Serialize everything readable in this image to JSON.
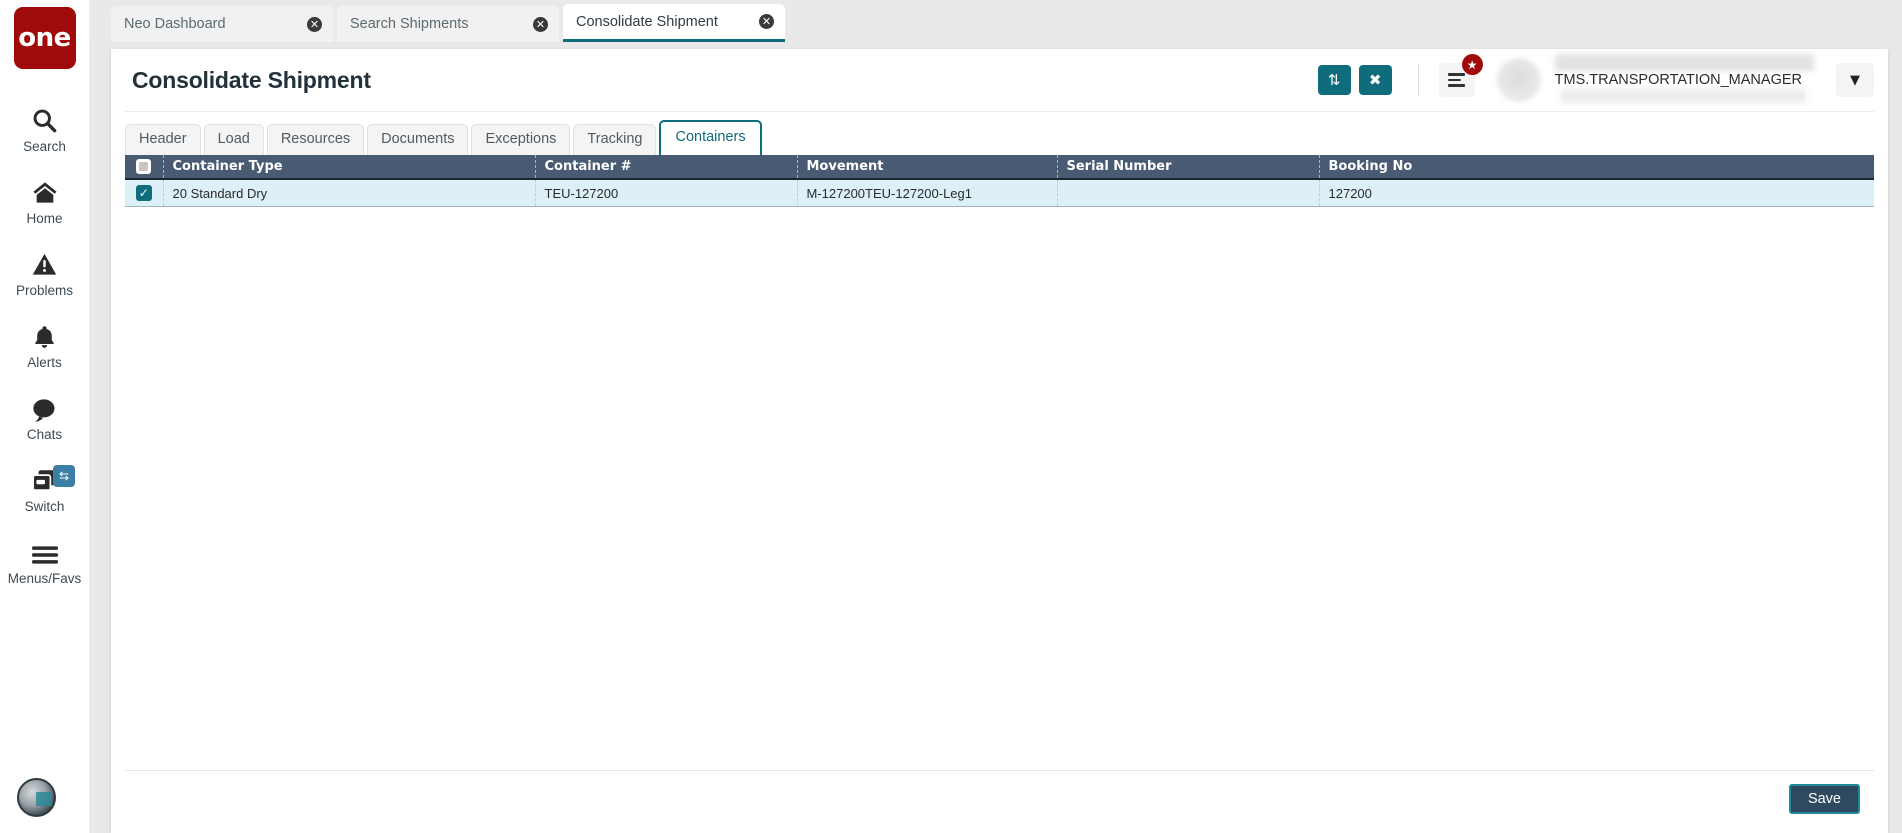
{
  "brand": {
    "logo_text": "one"
  },
  "sidebar": {
    "items": [
      {
        "label": "Search",
        "icon": "search-icon"
      },
      {
        "label": "Home",
        "icon": "home-icon"
      },
      {
        "label": "Problems",
        "icon": "warning-triangle-icon"
      },
      {
        "label": "Alerts",
        "icon": "bell-icon"
      },
      {
        "label": "Chats",
        "icon": "chat-bubble-icon"
      },
      {
        "label": "Switch",
        "icon": "switch-windows-icon",
        "badge_icon": "swap-arrows-icon"
      },
      {
        "label": "Menus/Favs",
        "icon": "hamburger-icon"
      }
    ],
    "assistant_icon": "assistant-avatar-icon"
  },
  "browser_tabs": [
    {
      "label": "Neo Dashboard",
      "active": false,
      "close_icon": "close-circle-icon"
    },
    {
      "label": "Search Shipments",
      "active": false,
      "close_icon": "close-circle-icon"
    },
    {
      "label": "Consolidate Shipment",
      "active": true,
      "close_icon": "close-circle-icon"
    }
  ],
  "header": {
    "title": "Consolidate Shipment",
    "refresh_icon": "refresh-icon",
    "close_icon": "close-x-icon",
    "menu_icon": "hamburger-menu-icon",
    "badge_icon": "star-icon",
    "avatar_icon": "user-avatar",
    "username": "TMS.TRANSPORTATION_MANAGER",
    "caret_icon": "chevron-down-icon"
  },
  "tabs": [
    {
      "label": "Header",
      "active": false
    },
    {
      "label": "Load",
      "active": false
    },
    {
      "label": "Resources",
      "active": false
    },
    {
      "label": "Documents",
      "active": false
    },
    {
      "label": "Exceptions",
      "active": false
    },
    {
      "label": "Tracking",
      "active": false
    },
    {
      "label": "Containers",
      "active": true
    }
  ],
  "table": {
    "columns": [
      "Container Type",
      "Container #",
      "Movement",
      "Serial Number",
      "Booking No"
    ],
    "select_all_state": "indeterminate",
    "rows": [
      {
        "selected": true,
        "container_type": "20 Standard Dry",
        "container_no": "TEU-127200",
        "movement": "M-127200TEU-127200-Leg1",
        "serial_number": "",
        "booking_no": "127200"
      }
    ]
  },
  "footer": {
    "save_label": "Save"
  },
  "colors": {
    "brand_red": "#a00a0a",
    "accent_teal": "#0f6c7c",
    "table_header": "#485b72",
    "row_selected": "#ddeff7",
    "save_button": "#2f4a60"
  }
}
